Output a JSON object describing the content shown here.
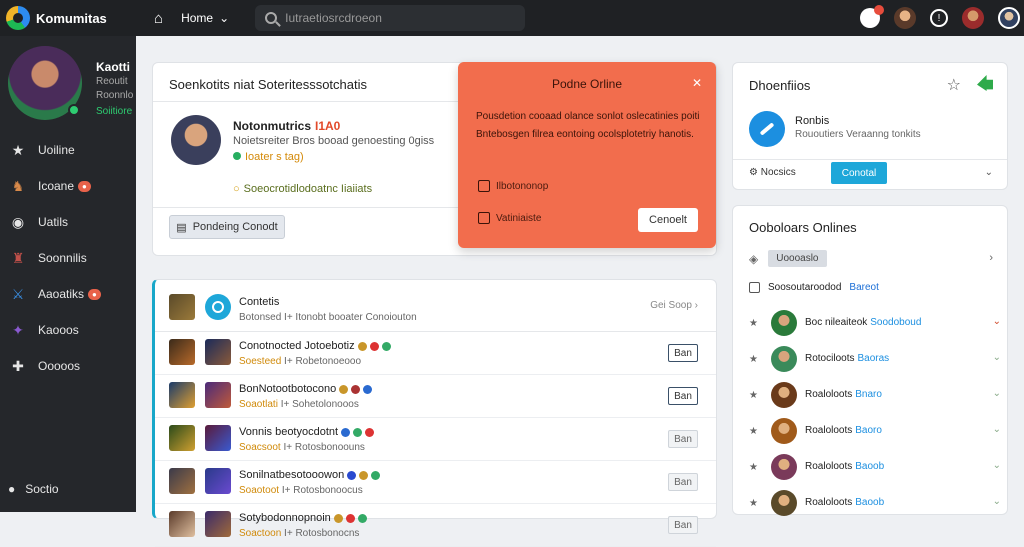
{
  "topbar": {
    "brand": "Komumitas",
    "home_label": "Home",
    "search_placeholder": "Iutraetiosrcdroeon"
  },
  "sidebar": {
    "profile": {
      "name": "Kaotti",
      "sub1": "Reoutit",
      "sub2": "Roonnlo",
      "status": "Soiitiore"
    },
    "items": [
      {
        "label": "Uoiline",
        "icon": "star-icon"
      },
      {
        "label": "Icoane",
        "icon": "game-icon",
        "badge": ""
      },
      {
        "label": "Uatils",
        "icon": "circle-icon"
      },
      {
        "label": "Soonnilis",
        "icon": "hero-icon"
      },
      {
        "label": "Aaoatiks",
        "icon": "swords-icon",
        "badge": ""
      },
      {
        "label": "Kaooos",
        "icon": "mage-icon"
      },
      {
        "label": "Ooooos",
        "icon": "puzzle-icon"
      }
    ],
    "settings_label": "Soctio"
  },
  "profile_card": {
    "title": "Soenkotits niat Soteritesssotchatis",
    "name": "Notonmutrics",
    "name_tag": "I1A0",
    "desc": "Noietsreiter Bros booad genoesting 0giss",
    "stat": "Ioater s tag)",
    "line": "Soeocrotidlodoatnc Iiaiiats",
    "pending": "Pondeing Conodt"
  },
  "popup": {
    "title": "Podne Orline",
    "body": "Pousdetion cooaad olance sonlot oslecatinies poiti Bntebosgen filrea eontoing ocolsplotetriy hanotis.",
    "option1": "Ilbotononop",
    "option2": "Vatiniaiste",
    "cancel": "Cenoelt"
  },
  "friends": {
    "title": "Contetis",
    "sub": "Botonsed I+ Itonobt booater Conoiouton",
    "see_all": "Gei Soop",
    "rows": [
      {
        "name": "Conotnocted Jotoebotiz",
        "sub_a": "Soesteed",
        "sub_b": "I+ Robetonoeooo",
        "btn": "Ban",
        "light": false
      },
      {
        "name": "BonNotootbotocono",
        "sub_a": "Soaotlati",
        "sub_b": "I+ Sohetolonooos",
        "btn": "Ban",
        "light": false
      },
      {
        "name": "Vonnis beotyocdotnt",
        "sub_a": "Soacsoot",
        "sub_b": "I+ Rotosbonoouns",
        "btn": "Ban",
        "light": true
      },
      {
        "name": "Sonilnatbesotooowon",
        "sub_a": "Soaotoot",
        "sub_b": "I+ Rotosbonoocus",
        "btn": "Ban",
        "light": true
      },
      {
        "name": "Sotybodonnopnoin",
        "sub_a": "Soactoon",
        "sub_b": "I+ Rotosbonocns",
        "btn": "Ban",
        "light": true
      }
    ]
  },
  "right_card": {
    "title": "Dhoenfiios",
    "name": "Ronbis",
    "sub": "Rououtiers Veraanng tonkits",
    "foot_label": "Nocsics",
    "contact": "Conotal"
  },
  "online_card": {
    "title": "Ooboloars Onlines",
    "chip": "Uoooaslo",
    "selector": "Soosoutaroodod",
    "selector_link": "Bareot",
    "rows": [
      {
        "name": "Boc nileaiteok",
        "status": "Soodoboud"
      },
      {
        "name": "Rotociloots",
        "status": "Baoras"
      },
      {
        "name": "Roaloloots",
        "status": "Bnaro"
      },
      {
        "name": "Roaloloots",
        "status": "Baoro"
      },
      {
        "name": "Roaloloots",
        "status": "Baoob"
      },
      {
        "name": "Roaloloots",
        "status": "Baoob"
      }
    ]
  },
  "colors": {
    "accent": "#1ea7d9",
    "popup": "#f26d4d",
    "sidebar": "#25272b",
    "topbar": "#1f2124"
  }
}
